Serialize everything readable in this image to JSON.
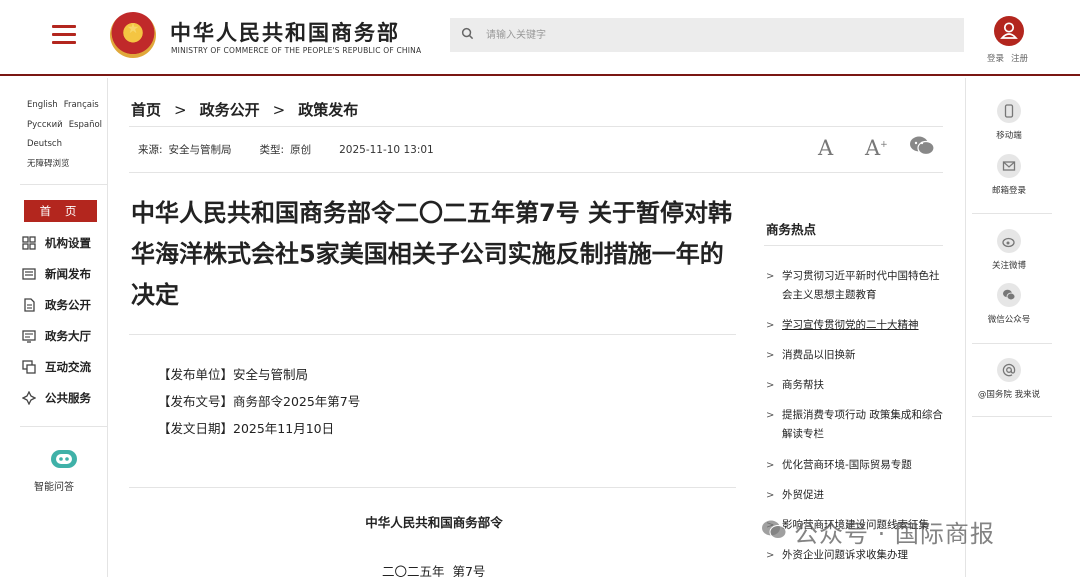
{
  "header": {
    "logo_cn": "中华人民共和国商务部",
    "logo_en": "MINISTRY OF COMMERCE OF THE PEOPLE'S REPUBLIC OF CHINA",
    "search_placeholder": "请输入关键字",
    "login": "登录",
    "register": "注册",
    "accent_color": "#b3261e"
  },
  "left_sidebar": {
    "languages": [
      "English",
      "Français",
      "Русский",
      "Español",
      "Deutsch",
      "无障碍浏览"
    ],
    "home_label": "首 页",
    "nav": [
      {
        "label": "机构设置",
        "icon": "org-icon"
      },
      {
        "label": "新闻发布",
        "icon": "news-icon"
      },
      {
        "label": "政务公开",
        "icon": "document-icon"
      },
      {
        "label": "政务大厅",
        "icon": "hall-icon"
      },
      {
        "label": "互动交流",
        "icon": "chat-icon"
      },
      {
        "label": "公共服务",
        "icon": "service-icon"
      }
    ],
    "assistant_label": "智能问答"
  },
  "breadcrumb": [
    "首页",
    "政务公开",
    "政策发布"
  ],
  "meta": {
    "source_key": "来源:",
    "source": "安全与管制局",
    "type_key": "类型:",
    "type": "原创",
    "datetime": "2025-11-10 13:01"
  },
  "toolbar": {
    "font_large": "A",
    "font_small": "A",
    "font_small_sup": "+"
  },
  "article": {
    "title": "中华人民共和国商务部令二〇二五年第7号 关于暂停对韩华海洋株式会社5家美国相关子公司实施反制措施一年的决定",
    "info": [
      "【发布单位】安全与管制局",
      "【发布文号】商务部令2025年第7号",
      "【发文日期】2025年11月10日"
    ],
    "issuer": "中华人民共和国商务部令",
    "order_no": "二〇二五年  第7号"
  },
  "hot_topics": {
    "title": "商务热点",
    "items": [
      "学习贯彻习近平新时代中国特色社会主义思想主题教育",
      "学习宣传贯彻党的二十大精神",
      "消费品以旧换新",
      "商务帮扶",
      "提振消费专项行动 政策集成和综合解读专栏",
      "优化营商环境-国际贸易专题",
      "外贸促进",
      "影响营商环境建设问题线索征集",
      "外资企业问题诉求收集办理"
    ]
  },
  "right_sidebar": {
    "items": [
      {
        "label": "移动端",
        "icon": "mobile-icon"
      },
      {
        "label": "邮箱登录",
        "icon": "mail-icon"
      },
      {
        "label": "关注微博",
        "icon": "weibo-icon"
      },
      {
        "label": "微信公众号",
        "icon": "wechat-icon"
      },
      {
        "label": "@国务院 我来说",
        "icon": "at-icon"
      }
    ]
  },
  "watermark": "公众号 · 国际商报"
}
